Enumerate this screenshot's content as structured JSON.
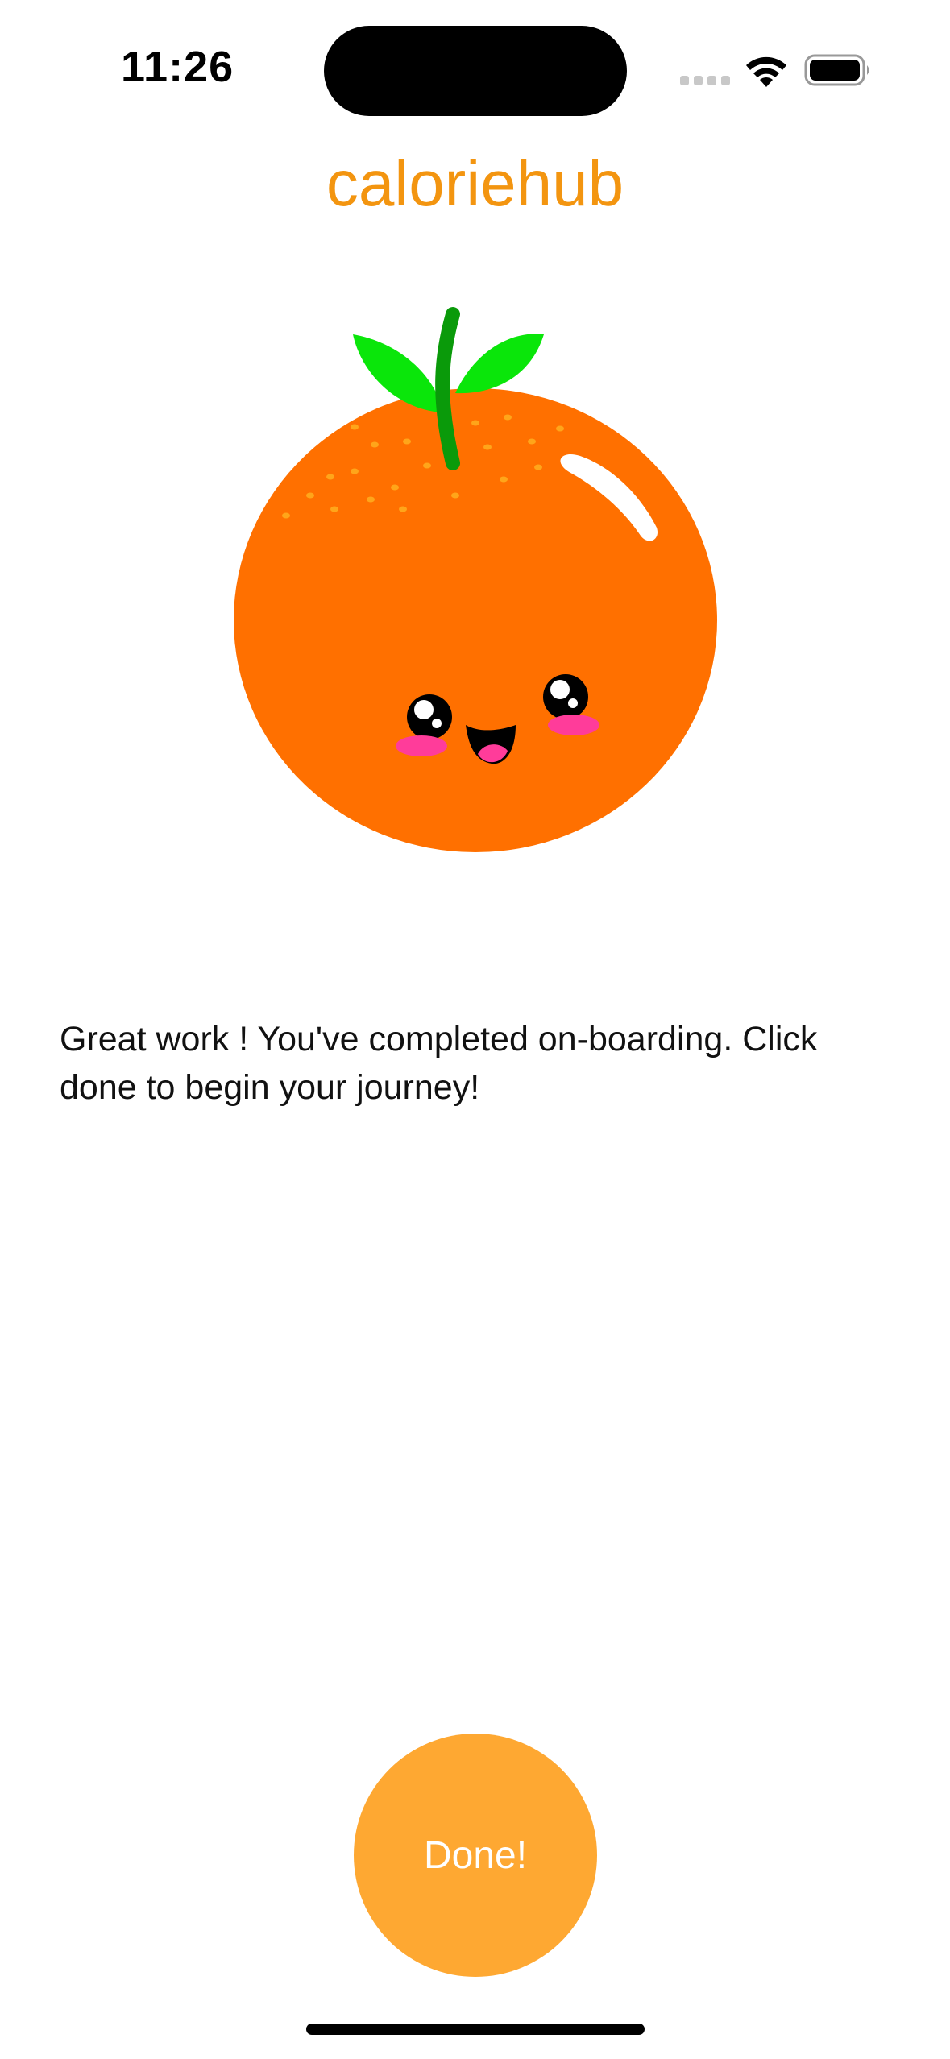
{
  "status_bar": {
    "time": "11:26",
    "icons": [
      "signal-icon",
      "wifi-icon",
      "battery-icon"
    ]
  },
  "header": {
    "title": "caloriehub"
  },
  "mascot": {
    "icon": "orange-mascot-icon"
  },
  "main": {
    "message": "Great work ! You've completed on-boarding. Click done to begin your journey!"
  },
  "actions": {
    "done_label": "Done!"
  },
  "colors": {
    "brand": "#f39510",
    "button": "#fea832",
    "orange_body": "#ff7000",
    "leaf": "#0ae60a",
    "stem": "#0a9a0a",
    "blush": "#ff3c9a"
  }
}
